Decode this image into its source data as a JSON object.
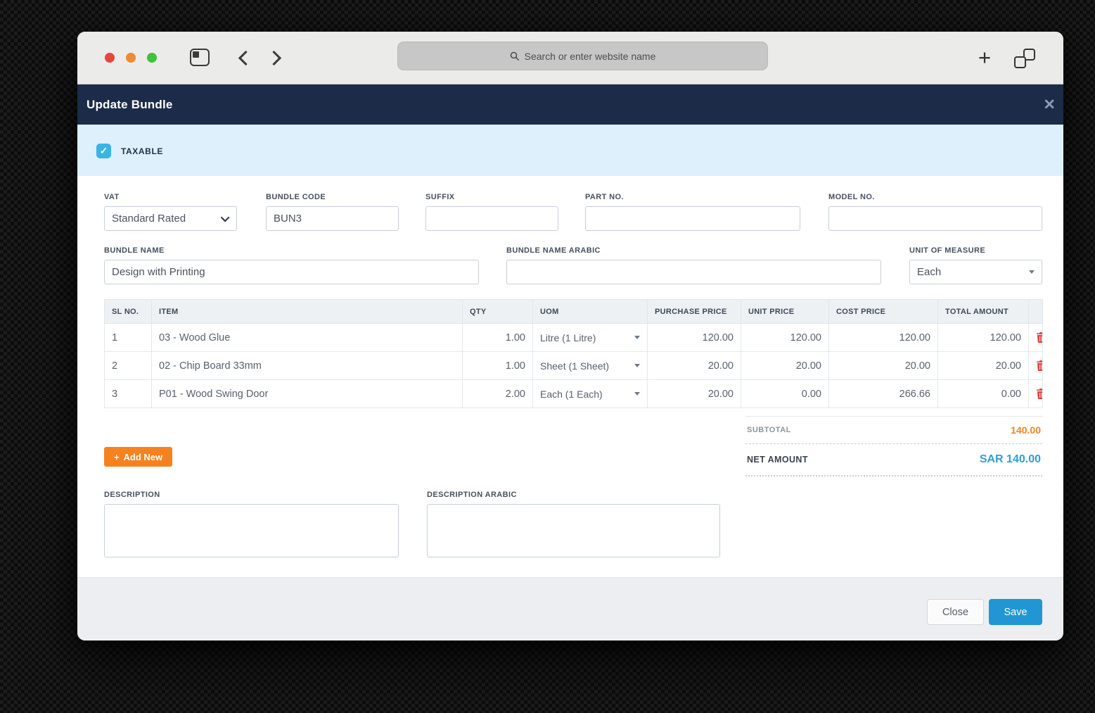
{
  "browser": {
    "address_placeholder": "Search or enter website name"
  },
  "icons": {
    "close_glyph": "✕",
    "check_glyph": "✓",
    "plus_glyph": "+"
  },
  "modal": {
    "title": "Update Bundle"
  },
  "taxable": {
    "label": "TAXABLE",
    "checked": true
  },
  "fields": {
    "vat": {
      "label": "VAT",
      "value": "Standard Rated"
    },
    "bundle_code": {
      "label": "BUNDLE CODE",
      "value": "BUN3"
    },
    "suffix": {
      "label": "SUFFIX",
      "value": ""
    },
    "part_no": {
      "label": "PART NO.",
      "value": ""
    },
    "model_no": {
      "label": "MODEL NO.",
      "value": ""
    },
    "bundle_name": {
      "label": "BUNDLE NAME",
      "value": "Design with Printing"
    },
    "bundle_name_arabic": {
      "label": "BUNDLE NAME ARABIC",
      "value": ""
    },
    "unit_of_measure": {
      "label": "UNIT OF MEASURE",
      "value": "Each"
    },
    "description": {
      "label": "DESCRIPTION",
      "value": ""
    },
    "description_arabic": {
      "label": "DESCRIPTION ARABIC",
      "value": ""
    }
  },
  "items_table": {
    "headers": [
      "SL NO.",
      "ITEM",
      "QTY",
      "UOM",
      "PURCHASE PRICE",
      "UNIT PRICE",
      "COST PRICE",
      "TOTAL AMOUNT"
    ],
    "rows": [
      {
        "sl_no": "1",
        "item": "03 - Wood Glue",
        "qty": "1.00",
        "uom": "Litre (1 Litre)",
        "purchase_price": "120.00",
        "unit_price": "120.00",
        "cost_price": "120.00",
        "total_amount": "120.00"
      },
      {
        "sl_no": "2",
        "item": "02 - Chip Board 33mm",
        "qty": "1.00",
        "uom": "Sheet (1 Sheet)",
        "purchase_price": "20.00",
        "unit_price": "20.00",
        "cost_price": "20.00",
        "total_amount": "20.00"
      },
      {
        "sl_no": "3",
        "item": "P01 - Wood Swing Door",
        "qty": "2.00",
        "uom": "Each (1 Each)",
        "purchase_price": "20.00",
        "unit_price": "0.00",
        "cost_price": "266.66",
        "total_amount": "0.00"
      }
    ]
  },
  "actions": {
    "add_new_label": "Add New"
  },
  "totals": {
    "subtotal_label": "SUBTOTAL",
    "subtotal_value": "140.00",
    "net_amount_label": "NET AMOUNT",
    "net_amount_value": "SAR 140.00"
  },
  "footer": {
    "close_label": "Close",
    "save_label": "Save"
  },
  "colors": {
    "header_navy": "#1c2b47",
    "taxable_band_blue": "#def0fb",
    "checkbox_blue": "#39b4e7",
    "accent_orange": "#f6821f",
    "accent_blue": "#2d9fd9",
    "delete_red": "#df4040"
  }
}
